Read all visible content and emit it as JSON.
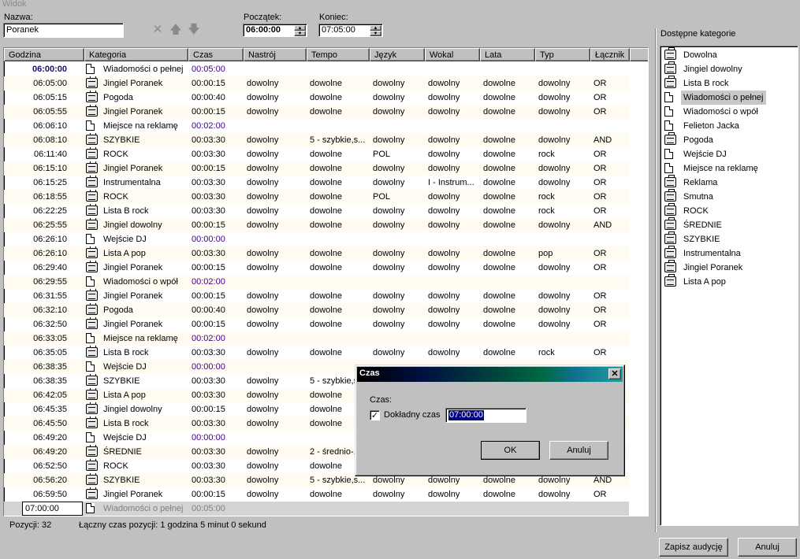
{
  "window": {
    "title": "Widok"
  },
  "form": {
    "name_label": "Nazwa:",
    "name_value": "Poranek",
    "start_label": "Początek:",
    "start_value": "06:00:00",
    "end_label": "Koniec:",
    "end_value": "07:05:00"
  },
  "grid": {
    "columns": [
      "Godzina",
      "Kategoria",
      "Czas",
      "Nastrój",
      "Tempo",
      "Język",
      "Wokal",
      "Lata",
      "Typ",
      "Łącznik"
    ],
    "rows": [
      {
        "time": "06:00:00",
        "icon": "note",
        "cat": "Wiadomości o pełnej",
        "czas": "00:05:00",
        "nast": "",
        "tempo": "",
        "jez": "",
        "wok": "",
        "lata": "",
        "typ": "",
        "lacz": "",
        "bold": true
      },
      {
        "time": "06:05:00",
        "icon": "radio",
        "cat": "Jingiel Poranek",
        "czas": "00:00:15",
        "nast": "dowolny",
        "tempo": "dowolne",
        "jez": "dowolny",
        "wok": "dowolny",
        "lata": "dowolne",
        "typ": "dowolny",
        "lacz": "OR"
      },
      {
        "time": "06:05:15",
        "icon": "radio",
        "cat": "Pogoda",
        "czas": "00:00:40",
        "nast": "dowolny",
        "tempo": "dowolne",
        "jez": "dowolny",
        "wok": "dowolny",
        "lata": "dowolne",
        "typ": "dowolny",
        "lacz": "OR"
      },
      {
        "time": "06:05:55",
        "icon": "radio",
        "cat": "Jingiel Poranek",
        "czas": "00:00:15",
        "nast": "dowolny",
        "tempo": "dowolne",
        "jez": "dowolny",
        "wok": "dowolny",
        "lata": "dowolne",
        "typ": "dowolny",
        "lacz": "OR"
      },
      {
        "time": "06:06:10",
        "icon": "note",
        "cat": "Miejsce na reklamę",
        "czas": "00:02:00",
        "nast": "",
        "tempo": "",
        "jez": "",
        "wok": "",
        "lata": "",
        "typ": "",
        "lacz": ""
      },
      {
        "time": "06:08:10",
        "icon": "radio",
        "cat": "SZYBKIE",
        "czas": "00:03:30",
        "nast": "dowolny",
        "tempo": "5 - szybkie,s...",
        "jez": "dowolny",
        "wok": "dowolny",
        "lata": "dowolne",
        "typ": "dowolny",
        "lacz": "AND"
      },
      {
        "time": "06:11:40",
        "icon": "radio",
        "cat": "ROCK",
        "czas": "00:03:30",
        "nast": "dowolny",
        "tempo": "dowolne",
        "jez": "POL",
        "wok": "dowolny",
        "lata": "dowolne",
        "typ": "rock",
        "lacz": "OR"
      },
      {
        "time": "06:15:10",
        "icon": "radio",
        "cat": "Jingiel Poranek",
        "czas": "00:00:15",
        "nast": "dowolny",
        "tempo": "dowolne",
        "jez": "dowolny",
        "wok": "dowolny",
        "lata": "dowolne",
        "typ": "dowolny",
        "lacz": "OR"
      },
      {
        "time": "06:15:25",
        "icon": "radio",
        "cat": "Instrumentalna",
        "czas": "00:03:30",
        "nast": "dowolny",
        "tempo": "dowolne",
        "jez": "dowolny",
        "wok": "I - Instrum...",
        "lata": "dowolne",
        "typ": "dowolny",
        "lacz": "OR"
      },
      {
        "time": "06:18:55",
        "icon": "radio",
        "cat": "ROCK",
        "czas": "00:03:30",
        "nast": "dowolny",
        "tempo": "dowolne",
        "jez": "POL",
        "wok": "dowolny",
        "lata": "dowolne",
        "typ": "rock",
        "lacz": "OR"
      },
      {
        "time": "06:22:25",
        "icon": "radio",
        "cat": "Lista B rock",
        "czas": "00:03:30",
        "nast": "dowolny",
        "tempo": "dowolne",
        "jez": "dowolny",
        "wok": "dowolny",
        "lata": "dowolne",
        "typ": "rock",
        "lacz": "OR"
      },
      {
        "time": "06:25:55",
        "icon": "radio",
        "cat": "Jingiel dowolny",
        "czas": "00:00:15",
        "nast": "dowolny",
        "tempo": "dowolne",
        "jez": "dowolny",
        "wok": "dowolny",
        "lata": "dowolne",
        "typ": "dowolny",
        "lacz": "AND"
      },
      {
        "time": "06:26:10",
        "icon": "note",
        "cat": "Wejście DJ",
        "czas": "00:00:00",
        "nast": "",
        "tempo": "",
        "jez": "",
        "wok": "",
        "lata": "",
        "typ": "",
        "lacz": ""
      },
      {
        "time": "06:26:10",
        "icon": "radio",
        "cat": "Lista A pop",
        "czas": "00:03:30",
        "nast": "dowolny",
        "tempo": "dowolne",
        "jez": "dowolny",
        "wok": "dowolny",
        "lata": "dowolne",
        "typ": "pop",
        "lacz": "OR"
      },
      {
        "time": "06:29:40",
        "icon": "radio",
        "cat": "Jingiel Poranek",
        "czas": "00:00:15",
        "nast": "dowolny",
        "tempo": "dowolne",
        "jez": "dowolny",
        "wok": "dowolny",
        "lata": "dowolne",
        "typ": "dowolny",
        "lacz": "OR"
      },
      {
        "time": "06:29:55",
        "icon": "note",
        "cat": "Wiadomości o wpół",
        "czas": "00:02:00",
        "nast": "",
        "tempo": "",
        "jez": "",
        "wok": "",
        "lata": "",
        "typ": "",
        "lacz": ""
      },
      {
        "time": "06:31:55",
        "icon": "radio",
        "cat": "Jingiel Poranek",
        "czas": "00:00:15",
        "nast": "dowolny",
        "tempo": "dowolne",
        "jez": "dowolny",
        "wok": "dowolny",
        "lata": "dowolne",
        "typ": "dowolny",
        "lacz": "OR"
      },
      {
        "time": "06:32:10",
        "icon": "radio",
        "cat": "Pogoda",
        "czas": "00:00:40",
        "nast": "dowolny",
        "tempo": "dowolne",
        "jez": "dowolny",
        "wok": "dowolny",
        "lata": "dowolne",
        "typ": "dowolny",
        "lacz": "OR"
      },
      {
        "time": "06:32:50",
        "icon": "radio",
        "cat": "Jingiel Poranek",
        "czas": "00:00:15",
        "nast": "dowolny",
        "tempo": "dowolne",
        "jez": "dowolny",
        "wok": "dowolny",
        "lata": "dowolne",
        "typ": "dowolny",
        "lacz": "OR"
      },
      {
        "time": "06:33:05",
        "icon": "note",
        "cat": "Miejsce na reklamę",
        "czas": "00:02:00",
        "nast": "",
        "tempo": "",
        "jez": "",
        "wok": "",
        "lata": "",
        "typ": "",
        "lacz": ""
      },
      {
        "time": "06:35:05",
        "icon": "radio",
        "cat": "Lista B rock",
        "czas": "00:03:30",
        "nast": "dowolny",
        "tempo": "dowolne",
        "jez": "dowolny",
        "wok": "dowolny",
        "lata": "dowolne",
        "typ": "rock",
        "lacz": "OR"
      },
      {
        "time": "06:38:35",
        "icon": "note",
        "cat": "Wejście DJ",
        "czas": "00:00:00",
        "nast": "",
        "tempo": "",
        "jez": "",
        "wok": "",
        "lata": "",
        "typ": "",
        "lacz": ""
      },
      {
        "time": "06:38:35",
        "icon": "radio",
        "cat": "SZYBKIE",
        "czas": "00:03:30",
        "nast": "dowolny",
        "tempo": "5 - szybkie,s...",
        "jez": "",
        "wok": "",
        "lata": "",
        "typ": "",
        "lacz": ""
      },
      {
        "time": "06:42:05",
        "icon": "radio",
        "cat": "Lista A pop",
        "czas": "00:03:30",
        "nast": "dowolny",
        "tempo": "dowolne",
        "jez": "",
        "wok": "",
        "lata": "",
        "typ": "",
        "lacz": ""
      },
      {
        "time": "06:45:35",
        "icon": "radio",
        "cat": "Jingiel dowolny",
        "czas": "00:00:15",
        "nast": "dowolny",
        "tempo": "dowolne",
        "jez": "",
        "wok": "",
        "lata": "",
        "typ": "",
        "lacz": ""
      },
      {
        "time": "06:45:50",
        "icon": "radio",
        "cat": "Lista B rock",
        "czas": "00:03:30",
        "nast": "dowolny",
        "tempo": "dowolne",
        "jez": "",
        "wok": "",
        "lata": "",
        "typ": "",
        "lacz": ""
      },
      {
        "time": "06:49:20",
        "icon": "note",
        "cat": "Wejście DJ",
        "czas": "00:00:00",
        "nast": "",
        "tempo": "",
        "jez": "",
        "wok": "",
        "lata": "",
        "typ": "",
        "lacz": ""
      },
      {
        "time": "06:49:20",
        "icon": "radio",
        "cat": "ŚREDNIE",
        "czas": "00:03:30",
        "nast": "dowolny",
        "tempo": "2 - średnio-...",
        "jez": "",
        "wok": "",
        "lata": "",
        "typ": "",
        "lacz": ""
      },
      {
        "time": "06:52:50",
        "icon": "radio",
        "cat": "ROCK",
        "czas": "00:03:30",
        "nast": "dowolny",
        "tempo": "dowolne",
        "jez": "",
        "wok": "",
        "lata": "",
        "typ": "",
        "lacz": ""
      },
      {
        "time": "06:56:20",
        "icon": "radio",
        "cat": "SZYBKIE",
        "czas": "00:03:30",
        "nast": "dowolny",
        "tempo": "5 - szybkie,s...",
        "jez": "dowolny",
        "wok": "dowolny",
        "lata": "dowolne",
        "typ": "dowolny",
        "lacz": "AND"
      },
      {
        "time": "06:59:50",
        "icon": "radio",
        "cat": "Jingiel Poranek",
        "czas": "00:00:15",
        "nast": "dowolny",
        "tempo": "dowolne",
        "jez": "dowolny",
        "wok": "dowolny",
        "lata": "dowolne",
        "typ": "dowolny",
        "lacz": "OR"
      }
    ],
    "new_row": {
      "time": "07:00:00",
      "icon": "note",
      "cat": "Wiadomości o pełnej",
      "czas": "00:05:00"
    }
  },
  "status": {
    "count_label": "Pozycji:",
    "count_value": "32",
    "total": "Łączny czas pozycji: 1 godzina 5 minut 0 sekund"
  },
  "categories": {
    "title": "Dostępne kategorie",
    "items": [
      {
        "label": "Dowolna",
        "icon": "radio"
      },
      {
        "label": "Jingiel dowolny",
        "icon": "radio"
      },
      {
        "label": "Lista B rock",
        "icon": "radio"
      },
      {
        "label": "Wiadomości o pełnej",
        "icon": "note",
        "selected": true
      },
      {
        "label": "Wiadomości o wpół",
        "icon": "note"
      },
      {
        "label": "Felieton Jacka",
        "icon": "note"
      },
      {
        "label": "Pogoda",
        "icon": "radio"
      },
      {
        "label": "Wejście DJ",
        "icon": "note"
      },
      {
        "label": "Miejsce na reklamę",
        "icon": "note"
      },
      {
        "label": "Reklama",
        "icon": "radio"
      },
      {
        "label": "Smutna",
        "icon": "radio"
      },
      {
        "label": "ROCK",
        "icon": "radio"
      },
      {
        "label": "ŚREDNIE",
        "icon": "radio"
      },
      {
        "label": "SZYBKIE",
        "icon": "radio"
      },
      {
        "label": "Instrumentalna",
        "icon": "radio"
      },
      {
        "label": "Jingiel Poranek",
        "icon": "radio"
      },
      {
        "label": "Lista A pop",
        "icon": "radio"
      }
    ]
  },
  "buttons": {
    "save": "Zapisz audycję",
    "cancel": "Anuluj"
  },
  "dialog": {
    "title": "Czas",
    "group_label": "Czas:",
    "exact_label": "Dokładny czas",
    "exact_checked": true,
    "time_value": "07:00:00",
    "ok": "OK",
    "cancel": "Anuluj"
  },
  "icons": {
    "delete": "x-icon",
    "up": "arrow-up-icon",
    "down": "arrow-down-icon",
    "close": "close-icon"
  },
  "glyphs": {
    "x": "✕",
    "up": "🡅",
    "down": "🡇",
    "close": "✕",
    "check": "✓",
    "spin_up": "▲",
    "spin_down": "▼"
  }
}
